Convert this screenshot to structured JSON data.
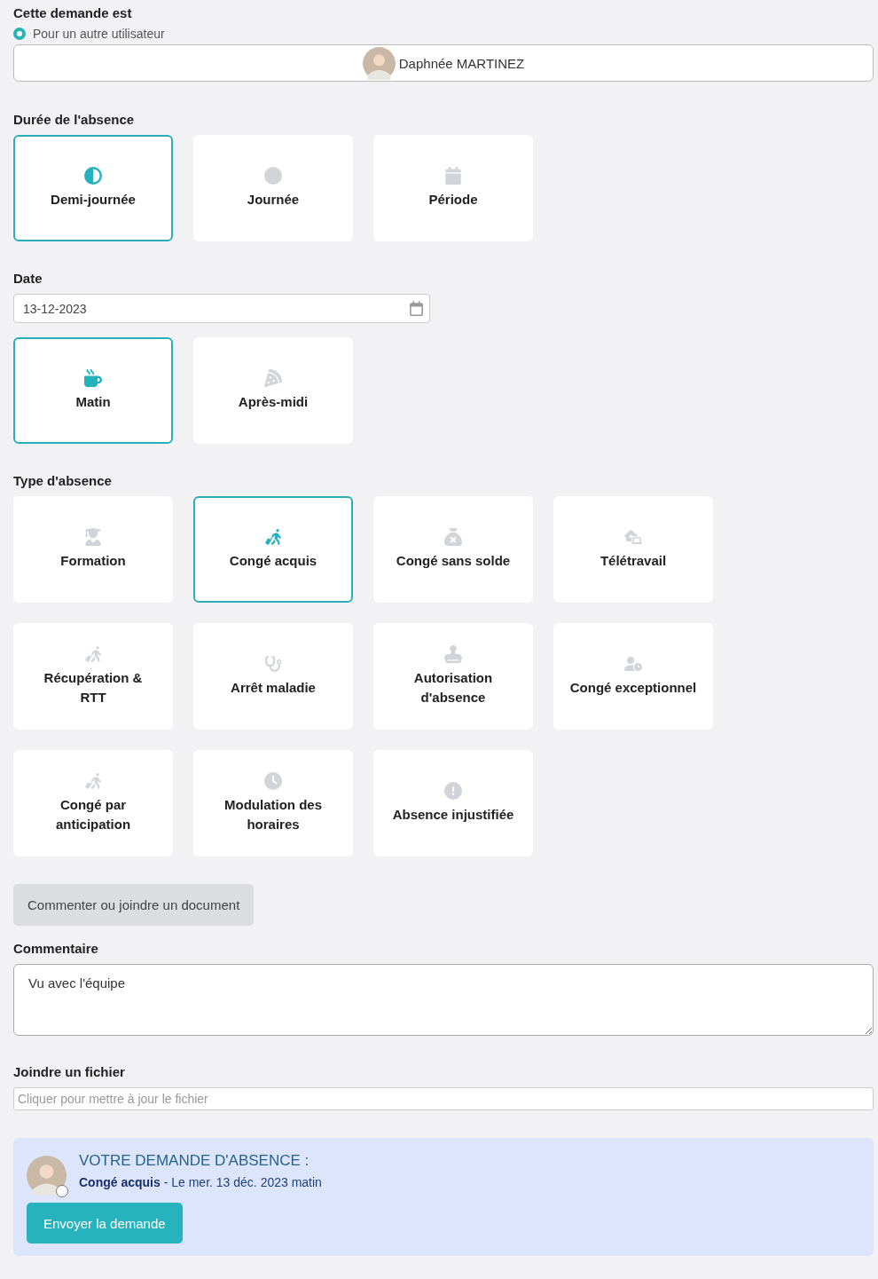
{
  "requester": {
    "title": "Cette demande est",
    "option": {
      "label": "Pour un autre utilisateur",
      "selected": true
    },
    "user": "Daphnée MARTINEZ"
  },
  "duration": {
    "title": "Durée de l'absence",
    "options": [
      {
        "label": "Demi-journée",
        "kind": "half",
        "selected": true
      },
      {
        "label": "Journée",
        "kind": "full",
        "selected": false
      },
      {
        "label": "Période",
        "kind": "period",
        "selected": false
      }
    ]
  },
  "date": {
    "title": "Date",
    "value": "13-12-2023",
    "options": [
      {
        "label": "Matin",
        "kind": "morning",
        "selected": true
      },
      {
        "label": "Après-midi",
        "kind": "afternoon",
        "selected": false
      }
    ]
  },
  "absence_type": {
    "title": "Type d'absence",
    "options": [
      {
        "label": "Formation",
        "kind": "training",
        "selected": false
      },
      {
        "label": "Congé acquis",
        "kind": "leave",
        "selected": true
      },
      {
        "label": "Congé sans solde",
        "kind": "unpaid",
        "selected": false
      },
      {
        "label": "Télétravail",
        "kind": "remote",
        "selected": false
      },
      {
        "label": "Récupération & RTT",
        "kind": "walk",
        "selected": false
      },
      {
        "label": "Arrêt maladie",
        "kind": "sick",
        "selected": false
      },
      {
        "label": "Autorisation d'absence",
        "kind": "stamp",
        "selected": false
      },
      {
        "label": "Congé exceptionnel",
        "kind": "userclock",
        "selected": false
      },
      {
        "label": "Congé par anticipation",
        "kind": "walk",
        "selected": false
      },
      {
        "label": "Modulation des horaires",
        "kind": "clock",
        "selected": false
      },
      {
        "label": "Absence injustifiée",
        "kind": "alert",
        "selected": false
      }
    ]
  },
  "attach_button": "Commenter ou joindre un document",
  "comment": {
    "title": "Commentaire",
    "value": "Vu avec l'équipe"
  },
  "file": {
    "title": "Joindre un fichier",
    "placeholder": "Cliquer pour mettre à jour le fichier"
  },
  "summary": {
    "title": "VOTRE DEMANDE D'ABSENCE :",
    "detail": "**Congé acquis** - Le mer. 13 déc. 2023 matin",
    "button": "Envoyer la demande"
  }
}
